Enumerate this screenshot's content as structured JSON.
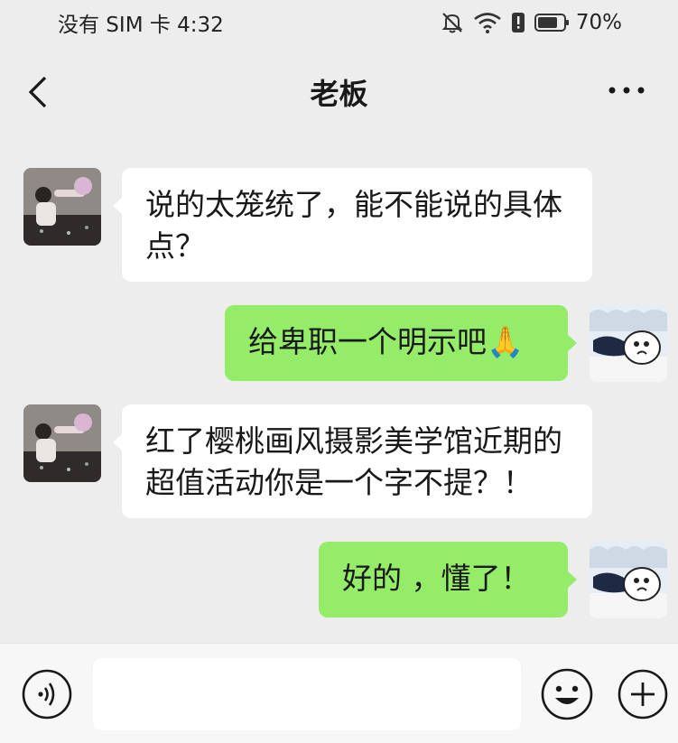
{
  "status_bar": {
    "carrier_time": "没有 SIM 卡 4:32",
    "battery": "70%",
    "icons": [
      "mute-bell-icon",
      "wifi-icon",
      "battery-icon"
    ]
  },
  "header": {
    "title": "老板",
    "back_icon": "chevron-left-icon",
    "more_icon": "more-dots-icon"
  },
  "messages": [
    {
      "sender": "boss",
      "text": "说的太笼统了，能不能说的具体点？"
    },
    {
      "sender": "me",
      "text": "给卑职一个明示吧🙏"
    },
    {
      "sender": "boss",
      "text": "红了樱桃画风摄影美学馆近期的超值活动你是一个字不提？！"
    },
    {
      "sender": "me",
      "text": "好的 ，懂了！"
    }
  ],
  "input_bar": {
    "value": "",
    "icons": [
      "voice-icon",
      "emoji-icon",
      "plus-icon"
    ]
  },
  "colors": {
    "background": "#ededed",
    "outgoing_bubble": "#95ec69",
    "incoming_bubble": "#ffffff"
  }
}
